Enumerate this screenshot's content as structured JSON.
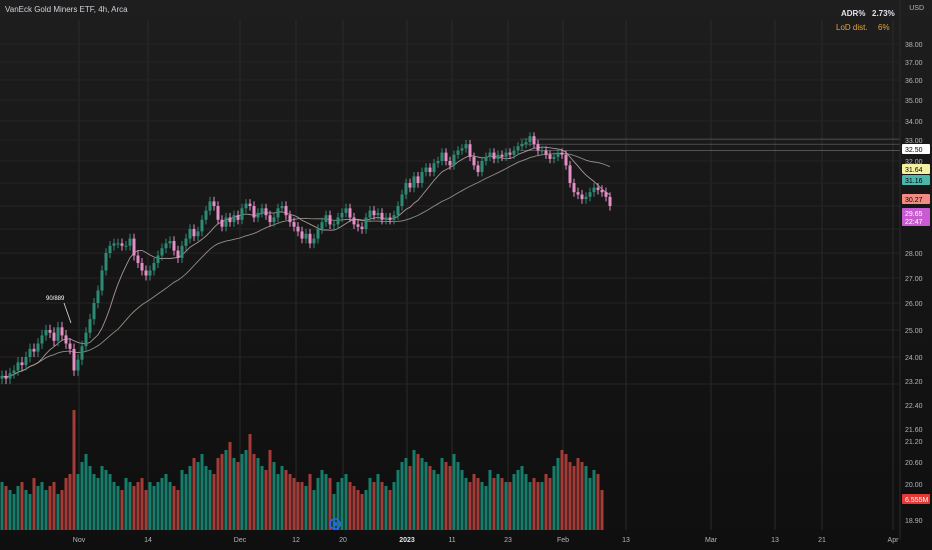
{
  "header": {
    "title": "VanEck Gold Miners ETF, 4h, Arca",
    "currency": "USD"
  },
  "indicators": {
    "adr_label": "ADR%",
    "adr_value": "2.73%",
    "lod_label": "LoD dist.",
    "lod_value": "6%"
  },
  "colors": {
    "up": "#26a69a",
    "down": "#ef5350",
    "candle_up": "#2e8b73",
    "candle_down": "#e48fc6",
    "vol_up": "#178a76",
    "vol_down": "#b5403b",
    "sma_fast": "#c4aab3",
    "sma_slow": "#a8a398"
  },
  "annotation": {
    "text": "90/889",
    "x": 4,
    "y": 25.0
  },
  "chart_data": {
    "type": "candlestick",
    "symbol": "VanEck Gold Miners ETF",
    "interval": "4h",
    "exchange": "Arca",
    "y_axis_labels": [
      "38.00",
      "37.00",
      "36.00",
      "35.00",
      "34.00",
      "33.00",
      "32.00",
      "28.00",
      "27.00",
      "26.00",
      "25.00",
      "24.00",
      "23.20",
      "22.40",
      "21.60",
      "21.20",
      "20.60",
      "20.00",
      "18.90"
    ],
    "x_axis_labels": [
      "Nov",
      "14",
      "Dec",
      "12",
      "20",
      "2023",
      "11",
      "23",
      "Feb",
      "13",
      "Mar",
      "13",
      "21",
      "Apr"
    ],
    "price_badges": [
      {
        "text": "32.50",
        "kind": "white"
      },
      {
        "text": "31.64",
        "kind": "yellow"
      },
      {
        "text": "31.16",
        "kind": "teal"
      },
      {
        "text": "30.27",
        "kind": "red"
      },
      {
        "text": "29.65",
        "kind": "pink"
      },
      {
        "text": "22:47",
        "kind": "pink"
      },
      {
        "text": "6.555M",
        "kind": "red"
      }
    ],
    "horizontal_levels": [
      33.05,
      32.8,
      32.5
    ],
    "close": [
      23.3,
      23.2,
      23.4,
      23.5,
      23.8,
      23.7,
      24.0,
      24.3,
      24.2,
      24.5,
      24.8,
      25.0,
      24.9,
      24.6,
      25.1,
      24.8,
      24.5,
      24.3,
      23.5,
      23.9,
      24.4,
      24.9,
      25.4,
      26.0,
      26.5,
      27.3,
      28.0,
      28.3,
      28.4,
      28.4,
      28.3,
      28.3,
      28.6,
      27.9,
      27.6,
      27.3,
      27.1,
      27.3,
      27.6,
      27.9,
      28.2,
      28.4,
      28.5,
      28.1,
      27.8,
      28.3,
      28.6,
      29.0,
      28.7,
      28.9,
      29.4,
      29.8,
      30.2,
      30.0,
      29.4,
      29.1,
      29.5,
      29.3,
      29.6,
      29.4,
      29.9,
      30.1,
      30.0,
      29.5,
      29.7,
      29.9,
      29.6,
      29.3,
      29.5,
      29.9,
      30.0,
      29.6,
      29.3,
      29.1,
      28.9,
      28.6,
      28.8,
      28.4,
      28.6,
      29.0,
      29.3,
      29.6,
      29.2,
      29.2,
      29.5,
      29.7,
      29.9,
      29.5,
      29.2,
      29.1,
      29.0,
      29.5,
      29.8,
      29.6,
      29.7,
      29.4,
      29.5,
      29.4,
      29.6,
      30.0,
      30.5,
      31.0,
      30.8,
      31.3,
      31.0,
      31.5,
      31.7,
      31.5,
      31.9,
      32.0,
      32.4,
      32.0,
      31.8,
      32.3,
      32.5,
      32.6,
      32.8,
      32.2,
      31.8,
      31.5,
      32.0,
      32.2,
      32.4,
      32.1,
      32.3,
      32.2,
      32.4,
      32.3,
      32.5,
      32.7,
      32.8,
      32.9,
      33.2,
      32.8,
      32.5,
      32.5,
      32.3,
      32.1,
      32.2,
      32.4,
      32.3,
      31.8,
      31.0,
      30.6,
      30.5,
      30.3,
      30.4,
      30.6,
      30.8,
      30.7,
      30.6,
      30.4,
      30.0
    ],
    "volume_M": [
      12,
      11,
      10,
      9,
      11,
      12,
      10,
      9,
      13,
      11,
      12,
      10,
      11,
      12,
      9,
      10,
      13,
      14,
      30,
      14,
      17,
      19,
      16,
      14,
      13,
      16,
      15,
      14,
      12,
      11,
      10,
      13,
      12,
      11,
      12,
      13,
      10,
      12,
      11,
      12,
      13,
      14,
      12,
      11,
      10,
      15,
      14,
      16,
      18,
      17,
      19,
      16,
      15,
      14,
      18,
      19,
      20,
      22,
      18,
      17,
      19,
      20,
      24,
      19,
      18,
      16,
      15,
      20,
      17,
      14,
      16,
      15,
      14,
      13,
      12,
      12,
      11,
      14,
      10,
      13,
      15,
      14,
      13,
      9,
      12,
      13,
      14,
      12,
      11,
      10,
      9,
      10,
      13,
      12,
      14,
      12,
      11,
      10,
      12,
      15,
      17,
      18,
      16,
      20,
      19,
      18,
      17,
      16,
      15,
      14,
      18,
      17,
      16,
      19,
      17,
      15,
      13,
      12,
      14,
      13,
      12,
      11,
      15,
      13,
      14,
      13,
      12,
      12,
      14,
      15,
      16,
      14,
      12,
      13,
      12,
      12,
      14,
      13,
      16,
      18,
      20,
      19,
      17,
      16,
      18,
      17,
      16,
      13,
      15,
      14,
      10
    ]
  }
}
